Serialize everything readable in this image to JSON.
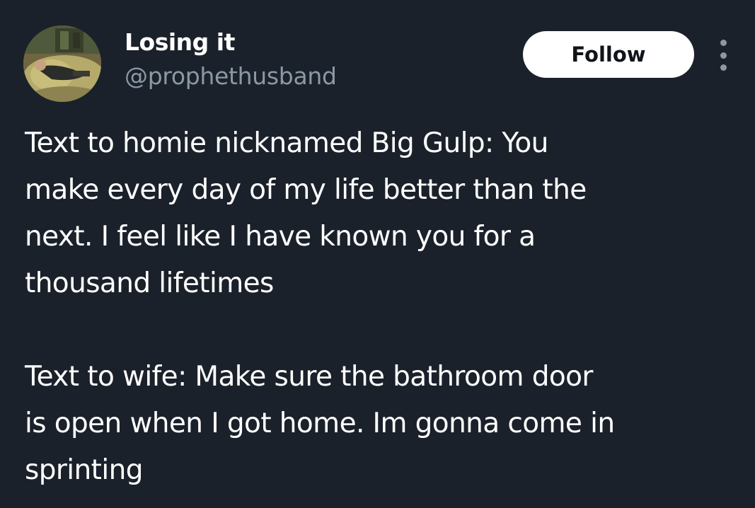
{
  "author": {
    "display_name": "Losing it",
    "handle": "@prophethusband"
  },
  "actions": {
    "follow_label": "Follow"
  },
  "tweet": {
    "paragraph_1": "Text to homie nicknamed Big Gulp: You\nmake every day of my life better than the\nnext. I feel like I have known you for a\nthousand lifetimes",
    "paragraph_2": "Text to wife: Make sure the bathroom door\nis open when I got home. Im gonna come in\nsprinting"
  },
  "theme": {
    "background": "#1b212a",
    "text": "#ffffff",
    "secondary_text": "#8b98a5",
    "follow_button_bg": "#ffffff",
    "follow_button_text": "#0f1419"
  },
  "icons": {
    "avatar": "profile-photo",
    "more": "more-options-icon"
  }
}
